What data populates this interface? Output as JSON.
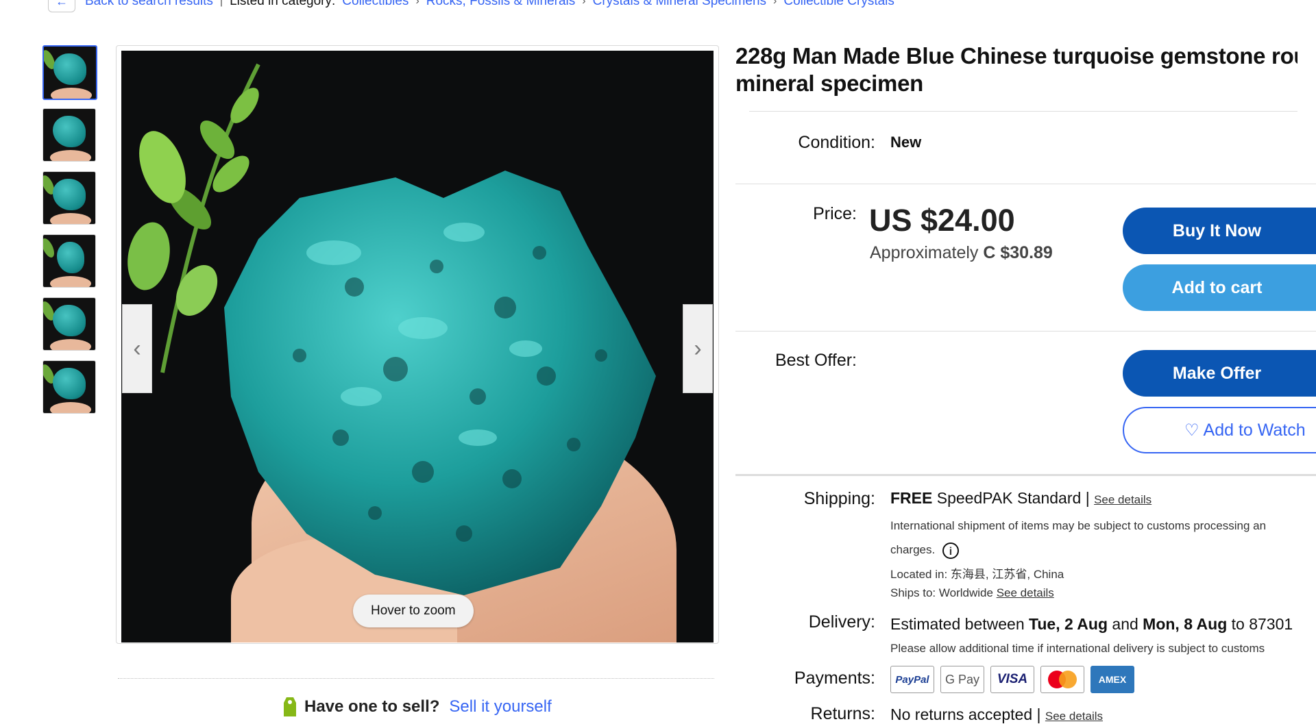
{
  "breadcrumb": {
    "back_label": "Back to search results",
    "listed_label": "Listed in category:",
    "items": [
      "Collectibles",
      "Rocks, Fossils & Minerals",
      "Crystals & Mineral Specimens",
      "Collectible Crystals"
    ]
  },
  "gallery": {
    "hover_zoom": "Hover to zoom",
    "thumbnail_count": 6
  },
  "sell": {
    "question": "Have one to sell?",
    "link": "Sell it yourself"
  },
  "item": {
    "title_line1": "228g Man Made Blue Chinese turquoise gemstone rou",
    "title_line2": "mineral specimen",
    "condition_label": "Condition:",
    "condition_value": "New",
    "price_label": "Price:",
    "price": "US $24.00",
    "approx_prefix": "Approximately",
    "approx_value": "C $30.89",
    "best_offer_label": "Best Offer:"
  },
  "buttons": {
    "buy_now": "Buy It Now",
    "add_to_cart": "Add to cart",
    "make_offer": "Make Offer",
    "add_to_watchlist": "Add to Watch"
  },
  "shipping": {
    "label": "Shipping:",
    "free": "FREE",
    "service": "SpeedPAK Standard",
    "sep": "|",
    "see_details": "See details",
    "customs_note": "International shipment of items may be subject to customs processing an",
    "customs_note_2": "charges.",
    "located_label": "Located in:",
    "located_value": "东海县, 江苏省, China",
    "ships_to_label": "Ships to:",
    "ships_to_value": "Worldwide",
    "ships_to_link": "See details"
  },
  "delivery": {
    "label": "Delivery:",
    "prefix": "Estimated between",
    "date1": "Tue, 2 Aug",
    "and": "and",
    "date2": "Mon, 8 Aug",
    "to": "to 87301",
    "note": "Please allow additional time if international delivery is subject to customs"
  },
  "payments": {
    "label": "Payments:",
    "methods": [
      "PayPal",
      "G Pay",
      "VISA",
      "Mastercard",
      "AMEX"
    ]
  },
  "returns": {
    "label": "Returns:",
    "value": "No returns accepted",
    "sep": "|",
    "link": "See details"
  },
  "colors": {
    "link": "#3665f3",
    "primary_button": "#0b56b3",
    "secondary_button": "#3c9fe0",
    "stone": "#1a9c9a"
  }
}
